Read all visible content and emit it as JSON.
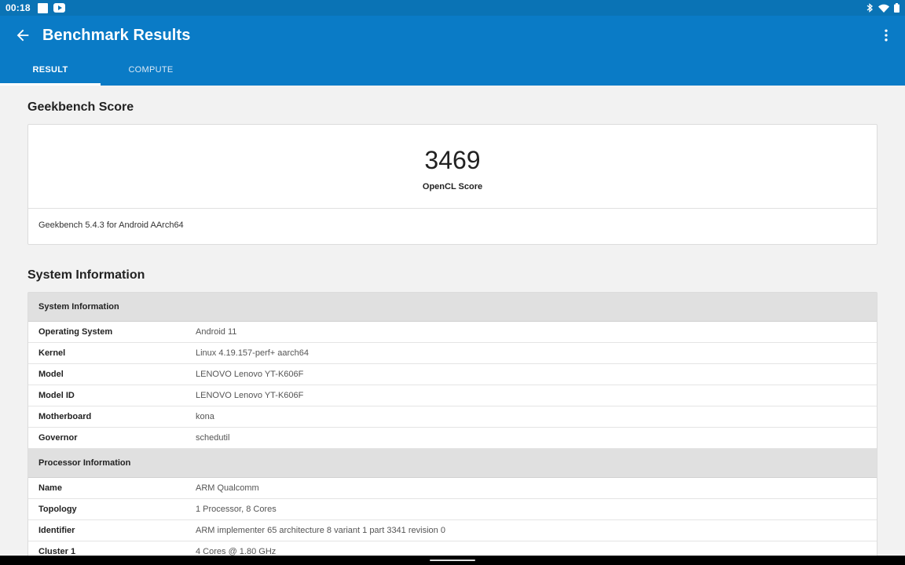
{
  "status_bar": {
    "time": "00:18"
  },
  "app_bar": {
    "title": "Benchmark Results",
    "tabs": [
      {
        "label": "RESULT",
        "active": true
      },
      {
        "label": "COMPUTE",
        "active": false
      }
    ]
  },
  "score_section": {
    "title": "Geekbench Score",
    "score": "3469",
    "score_label": "OpenCL Score",
    "version": "Geekbench 5.4.3 for Android AArch64"
  },
  "system_section": {
    "title": "System Information",
    "groups": [
      {
        "header": "System Information",
        "rows": [
          {
            "key": "Operating System",
            "value": "Android 11"
          },
          {
            "key": "Kernel",
            "value": "Linux 4.19.157-perf+ aarch64"
          },
          {
            "key": "Model",
            "value": "LENOVO Lenovo YT-K606F"
          },
          {
            "key": "Model ID",
            "value": "LENOVO Lenovo YT-K606F"
          },
          {
            "key": "Motherboard",
            "value": "kona"
          },
          {
            "key": "Governor",
            "value": "schedutil"
          }
        ]
      },
      {
        "header": "Processor Information",
        "rows": [
          {
            "key": "Name",
            "value": "ARM Qualcomm"
          },
          {
            "key": "Topology",
            "value": "1 Processor, 8 Cores"
          },
          {
            "key": "Identifier",
            "value": "ARM implementer 65 architecture 8 variant 1 part 3341 revision 0"
          },
          {
            "key": "Cluster 1",
            "value": "4 Cores @ 1.80 GHz"
          }
        ]
      }
    ]
  },
  "colors": {
    "app_bar": "#0a7bc6",
    "status_bar": "#0a73b5",
    "background": "#f2f2f2"
  }
}
